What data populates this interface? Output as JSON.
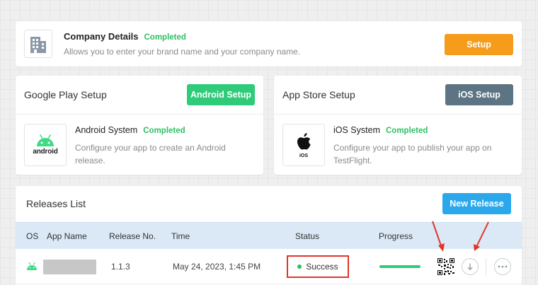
{
  "company": {
    "title": "Company Details",
    "status": "Completed",
    "description": "Allows you to enter your brand name and your company name.",
    "setup_button": "Setup"
  },
  "google_play": {
    "title": "Google Play Setup",
    "setup_button": "Android Setup",
    "item_title": "Android System",
    "status": "Completed",
    "description": "Configure your app to create an Android release.",
    "icon_label": "android"
  },
  "app_store": {
    "title": "App Store Setup",
    "setup_button": "iOS Setup",
    "item_title": "iOS System",
    "status": "Completed",
    "description": "Configure your app to publish your app on TestFlight.",
    "icon_label": "iOS"
  },
  "releases": {
    "title": "Releases List",
    "new_button": "New Release",
    "columns": [
      "OS",
      "App Name",
      "Release No.",
      "Time",
      "Status",
      "Progress"
    ],
    "rows": [
      {
        "os": "android-icon",
        "app_name": "",
        "release_no": "1.1.3",
        "time": "May 24, 2023, 1:45 PM",
        "status": "Success",
        "progress": 1.0
      }
    ]
  },
  "colors": {
    "completed": "#2fbf62",
    "setup": "#f59c1a",
    "android_setup": "#2fcb7a",
    "ios_setup": "#5c7483",
    "new_release": "#2ba8ec",
    "annotation_red": "#e0352a"
  }
}
